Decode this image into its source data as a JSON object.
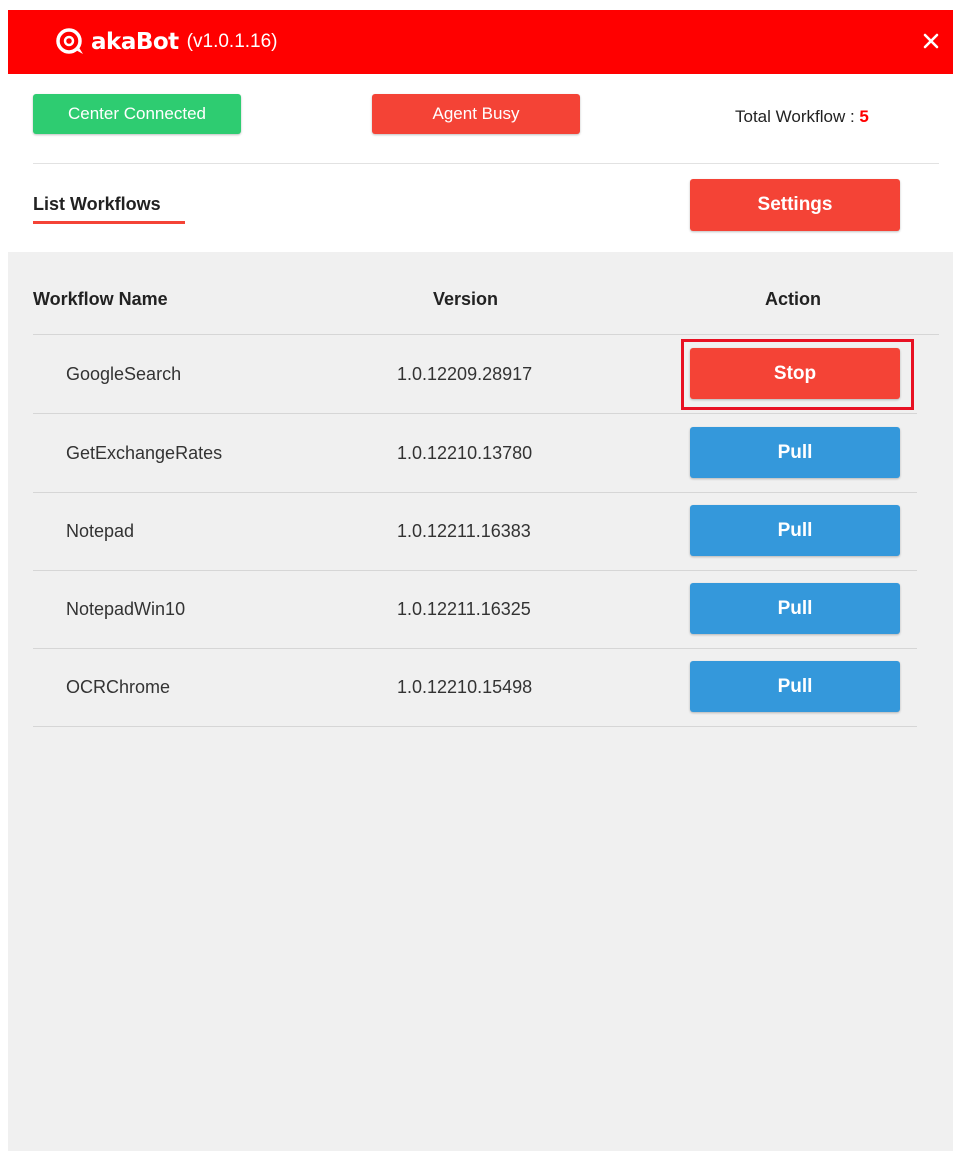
{
  "app": {
    "brand": "akaBot",
    "version": "(v1.0.1.16)"
  },
  "status": {
    "center_label": "Center Connected",
    "agent_label": "Agent Busy",
    "total_label": "Total Workflow : ",
    "total_count": "5"
  },
  "nav": {
    "tab_label": "List Workflows",
    "settings_label": "Settings"
  },
  "table": {
    "headers": {
      "name": "Workflow Name",
      "version": "Version",
      "action": "Action"
    },
    "rows": [
      {
        "name": "GoogleSearch",
        "version": "1.0.12209.28917",
        "action": "Stop"
      },
      {
        "name": "GetExchangeRates",
        "version": "1.0.12210.13780",
        "action": "Pull"
      },
      {
        "name": "Notepad",
        "version": "1.0.12211.16383",
        "action": "Pull"
      },
      {
        "name": "NotepadWin10",
        "version": "1.0.12211.16325",
        "action": "Pull"
      },
      {
        "name": "OCRChrome",
        "version": "1.0.12210.15498",
        "action": "Pull"
      }
    ]
  },
  "icons": {
    "logo": "akabot-logo-icon",
    "close": "close-icon"
  },
  "colors": {
    "titlebar": "#ff0000",
    "success": "#2ecc71",
    "danger": "#f44336",
    "primary": "#3498db",
    "highlight": "#e81123"
  }
}
